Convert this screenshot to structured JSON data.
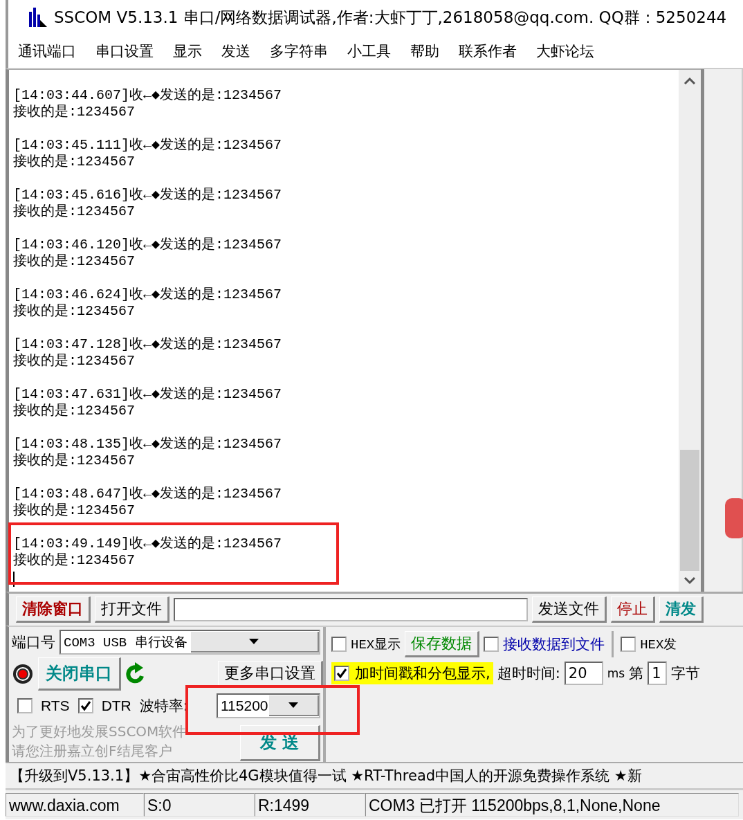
{
  "window": {
    "title": "SSCOM V5.13.1 串口/网络数据调试器,作者:大虾丁丁,2618058@qq.com. QQ群：5250244"
  },
  "menu": [
    "通讯端口",
    "串口设置",
    "显示",
    "发送",
    "多字符串",
    "小工具",
    "帮助",
    "联系作者",
    "大虾论坛"
  ],
  "log": {
    "entries": [
      {
        "header": "[14:03:44.607]收←◆发送的是:1234567",
        "body": "接收的是:1234567"
      },
      {
        "header": "[14:03:45.111]收←◆发送的是:1234567",
        "body": "接收的是:1234567"
      },
      {
        "header": "[14:03:45.616]收←◆发送的是:1234567",
        "body": "接收的是:1234567"
      },
      {
        "header": "[14:03:46.120]收←◆发送的是:1234567",
        "body": "接收的是:1234567"
      },
      {
        "header": "[14:03:46.624]收←◆发送的是:1234567",
        "body": "接收的是:1234567"
      },
      {
        "header": "[14:03:47.128]收←◆发送的是:1234567",
        "body": "接收的是:1234567"
      },
      {
        "header": "[14:03:47.631]收←◆发送的是:1234567",
        "body": "接收的是:1234567"
      },
      {
        "header": "[14:03:48.135]收←◆发送的是:1234567",
        "body": "接收的是:1234567"
      },
      {
        "header": "[14:03:48.647]收←◆发送的是:1234567",
        "body": "接收的是:1234567"
      },
      {
        "header": "[14:03:49.149]收←◆发送的是:1234567",
        "body": "接收的是:1234567"
      }
    ]
  },
  "toolbar": {
    "clear_button": "清除窗口",
    "open_file_button": "打开文件",
    "send_file_button": "发送文件",
    "stop_button": "停止",
    "clear_send_button": "清发"
  },
  "port": {
    "label": "端口号",
    "value": "COM3 USB 串行设备",
    "close_button": "关闭串口",
    "more_settings_button": "更多串口设置",
    "rts": {
      "label": "RTS",
      "checked": false
    },
    "dtr": {
      "label": "DTR",
      "checked": true
    },
    "baud_label": "波特率:",
    "baud_value": "115200",
    "notice": [
      "为了更好地发展SSCOM软件",
      "请您注册嘉立创F结尾客户"
    ],
    "send_button": "发 送"
  },
  "display": {
    "hex_display": {
      "label": "HEX显示",
      "checked": false
    },
    "save_button": "保存数据",
    "receive_to_file": {
      "label": "接收数据到文件",
      "checked": false
    },
    "hex_send": {
      "label": "HEX发",
      "checked": false
    },
    "timestamp": {
      "label": "加时间戳和分包显示,",
      "checked": true
    },
    "timeout_label": "超时时间:",
    "timeout_value": "20",
    "timeout_unit": "ms",
    "byte_prefix": "第",
    "byte_value": "1",
    "byte_suffix": "字节"
  },
  "ticker": "【升级到V5.13.1】★合宙高性价比4G模块值得一试 ★RT-Thread中国人的开源免费操作系统 ★新",
  "status_bar": [
    "www.daxia.com",
    "S:0",
    "R:1499",
    "COM3 已打开  115200bps,8,1,None,None"
  ]
}
